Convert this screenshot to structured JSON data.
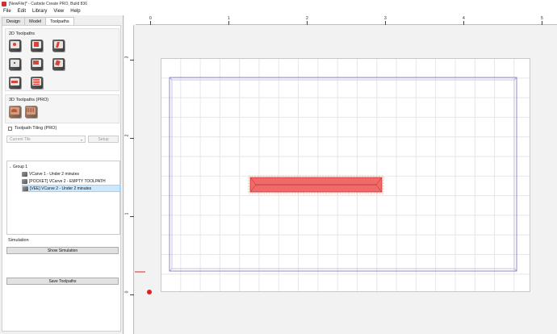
{
  "window": {
    "title": "[NewFile]* - Carbide Create PRO, Build 836"
  },
  "menu": {
    "items": [
      "File",
      "Edit",
      "Library",
      "View",
      "Help"
    ]
  },
  "tabs": [
    "Design",
    "Model",
    "Toolpaths"
  ],
  "active_tab": "Toolpaths",
  "toolpaths2d": {
    "label": "2D Toolpaths"
  },
  "toolpaths3d": {
    "label": "3D Toolpaths (PRO)"
  },
  "tiling": {
    "checkbox_label": "Toolpath Tiling (PRO)",
    "checked": false,
    "current_tile": "Current Tile",
    "setup_label": "Setup"
  },
  "tree": {
    "group_label": "Group 1",
    "items": [
      "VCarve 1 - Under 2 minutes",
      "[POCKET] VCarve 2 - EMPTY TOOLPATH",
      "[VEE] VCarve 2 - Under 2 minutes"
    ],
    "selected_index": 2
  },
  "simulation": {
    "label": "Simulation",
    "show_button": "Show Simulation"
  },
  "save_button": "Save Toolpaths",
  "ruler": {
    "x_labels": [
      "0",
      "1",
      "2",
      "3",
      "4",
      "5"
    ],
    "y_labels": [
      "3",
      "2",
      "1",
      "0"
    ]
  },
  "colors": {
    "accent_red": "#e02020",
    "toolpath_fill": "#f06a6a",
    "stock_outline": "#8c8cc8",
    "selection": "#cce8ff"
  }
}
